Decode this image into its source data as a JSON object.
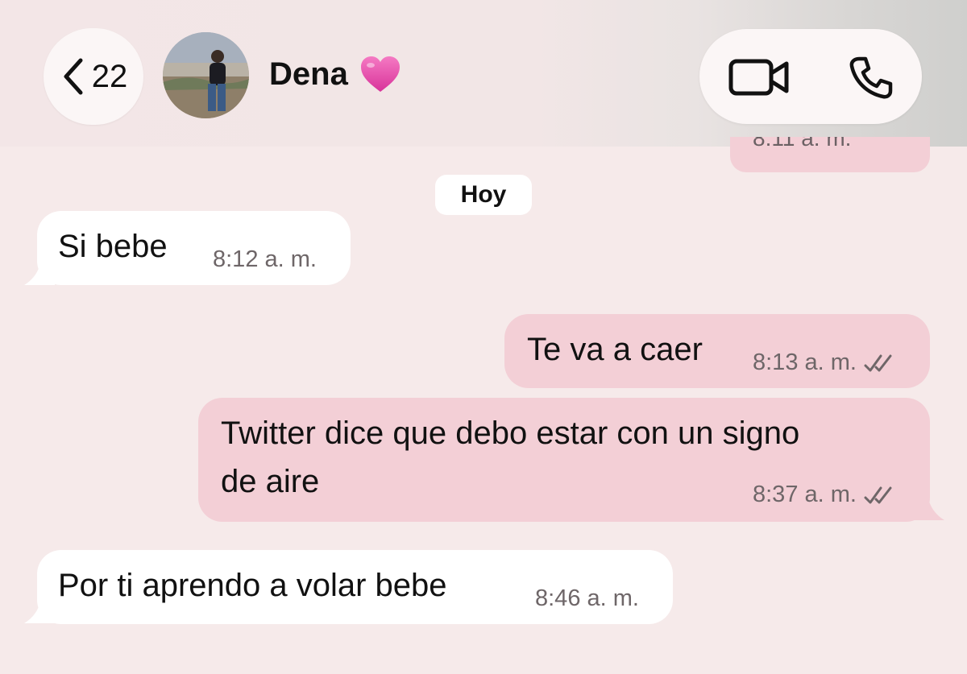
{
  "header": {
    "back_count": "22",
    "contact_name": "Dena",
    "name_emoji": "heart-emoji"
  },
  "previous_message": {
    "time_partial": "8:11 a. m."
  },
  "date_chip": "Hoy",
  "messages": [
    {
      "direction": "incoming",
      "text": "Si bebe",
      "time": "8:12 a. m."
    },
    {
      "direction": "outgoing",
      "text": "Te va a caer",
      "time": "8:13 a. m.",
      "status": "read-double-check"
    },
    {
      "direction": "outgoing",
      "text_line1": "Twitter dice que debo estar con un signo",
      "text_line2": "de aire",
      "time": "8:37 a. m.",
      "status": "read-double-check"
    },
    {
      "direction": "incoming",
      "text": "Por ti aprendo a volar bebe",
      "time": "8:46 a. m."
    }
  ],
  "colors": {
    "background": "#f6eaea",
    "incoming_bubble": "#ffffff",
    "outgoing_bubble": "#f3cfd6",
    "heart": "#e0409f"
  }
}
